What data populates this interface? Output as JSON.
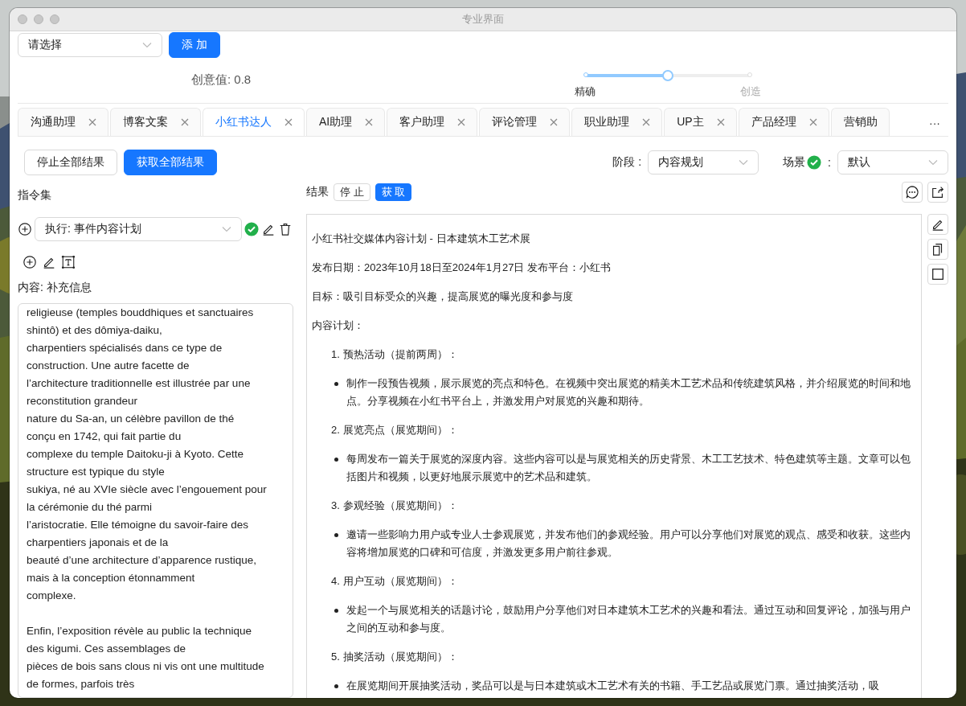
{
  "window": {
    "title": "专业界面"
  },
  "top": {
    "select_placeholder": "请选择",
    "add_button": "添 加"
  },
  "creativity": {
    "label": "创意值: 0.8",
    "level": 0.5,
    "min_label": "精确",
    "max_label": "创造"
  },
  "tabs": [
    {
      "label": "沟通助理",
      "selected": false,
      "closable": true
    },
    {
      "label": "博客文案",
      "selected": false,
      "closable": true
    },
    {
      "label": "小红书达人",
      "selected": true,
      "closable": true
    },
    {
      "label": "AI助理",
      "selected": false,
      "closable": true
    },
    {
      "label": "客户助理",
      "selected": false,
      "closable": true
    },
    {
      "label": "评论管理",
      "selected": false,
      "closable": true
    },
    {
      "label": "职业助理",
      "selected": false,
      "closable": true
    },
    {
      "label": "UP主",
      "selected": false,
      "closable": true
    },
    {
      "label": "产品经理",
      "selected": false,
      "closable": true
    },
    {
      "label": "营销助",
      "selected": false,
      "closable": false
    }
  ],
  "more_tabs": "···",
  "toolbar": {
    "stop_all": "停止全部结果",
    "fetch_all": "获取全部结果",
    "stage_label": "阶段 :",
    "stage_value": "内容规划",
    "scene_label": "场景",
    "scene_ok": true,
    "scene_colon": ":",
    "scene_value": "默认"
  },
  "left": {
    "title": "指令集",
    "command": {
      "value": "执行: 事件内容计划",
      "valid": true
    },
    "content_label": "内容: 补充信息",
    "content_text": "religieuse (temples bouddhiques et sanctuaires\nshintô) et des dômiya-daiku,\ncharpentiers spécialisés dans ce type de\nconstruction. Une autre facette de\nl’architecture traditionnelle est illustrée par une\nreconstitution grandeur\nnature du Sa-an, un célèbre pavillon de thé\nconçu en 1742, qui fait partie du\ncomplexe du temple Daitoku-ji à Kyoto. Cette\nstructure est typique du style\nsukiya, né au XVIe siècle avec l’engouement pour\nla cérémonie du thé parmi\nl’aristocratie. Elle témoigne du savoir-faire des\ncharpentiers japonais et de la\nbeauté d’une architecture d’apparence rustique,\nmais à la conception étonnamment\ncomplexe.\n\nEnfin, l’exposition révèle au public la technique\ndes kigumi. Ces assemblages de\npièces de bois sans clous ni vis ont une multitude\nde formes, parfois très"
  },
  "right": {
    "result_label": "结果",
    "stop_button": "停 止",
    "fetch_button": "获 取",
    "blocks": [
      {
        "kind": "paragraph",
        "text": "小红书社交媒体内容计划 - 日本建筑木工艺术展"
      },
      {
        "kind": "paragraph",
        "text": "发布日期：2023年10月18日至2024年1月27日 发布平台：小红书"
      },
      {
        "kind": "paragraph",
        "text": "目标：吸引目标受众的兴趣，提高展览的曝光度和参与度"
      },
      {
        "kind": "paragraph",
        "text": "内容计划："
      },
      {
        "kind": "numbered",
        "number": "1.",
        "text": "预热活动（提前两周）："
      },
      {
        "kind": "bullet",
        "text": "制作一段预告视频，展示展览的亮点和特色。在视频中突出展览的精美木工艺术品和传统建筑风格，并介绍展览的时间和地点。分享视频在小红书平台上，并激发用户对展览的兴趣和期待。"
      },
      {
        "kind": "numbered",
        "number": "2.",
        "text": "展览亮点（展览期间）："
      },
      {
        "kind": "bullet",
        "text": "每周发布一篇关于展览的深度内容。这些内容可以是与展览相关的历史背景、木工工艺技术、特色建筑等主题。文章可以包括图片和视频，以更好地展示展览中的艺术品和建筑。"
      },
      {
        "kind": "numbered",
        "number": "3.",
        "text": "参观经验（展览期间）："
      },
      {
        "kind": "bullet",
        "text": "邀请一些影响力用户或专业人士参观展览，并发布他们的参观经验。用户可以分享他们对展览的观点、感受和收获。这些内容将增加展览的口碑和可信度，并激发更多用户前往参观。"
      },
      {
        "kind": "numbered",
        "number": "4.",
        "text": "用户互动（展览期间）："
      },
      {
        "kind": "bullet",
        "text": "发起一个与展览相关的话题讨论，鼓励用户分享他们对日本建筑木工艺术的兴趣和看法。通过互动和回复评论，加强与用户之间的互动和参与度。"
      },
      {
        "kind": "numbered",
        "number": "5.",
        "text": "抽奖活动（展览期间）："
      },
      {
        "kind": "bullet",
        "text": "在展览期间开展抽奖活动，奖品可以是与日本建筑或木工艺术有关的书籍、手工艺品或展览门票。通过抽奖活动，吸"
      }
    ]
  }
}
